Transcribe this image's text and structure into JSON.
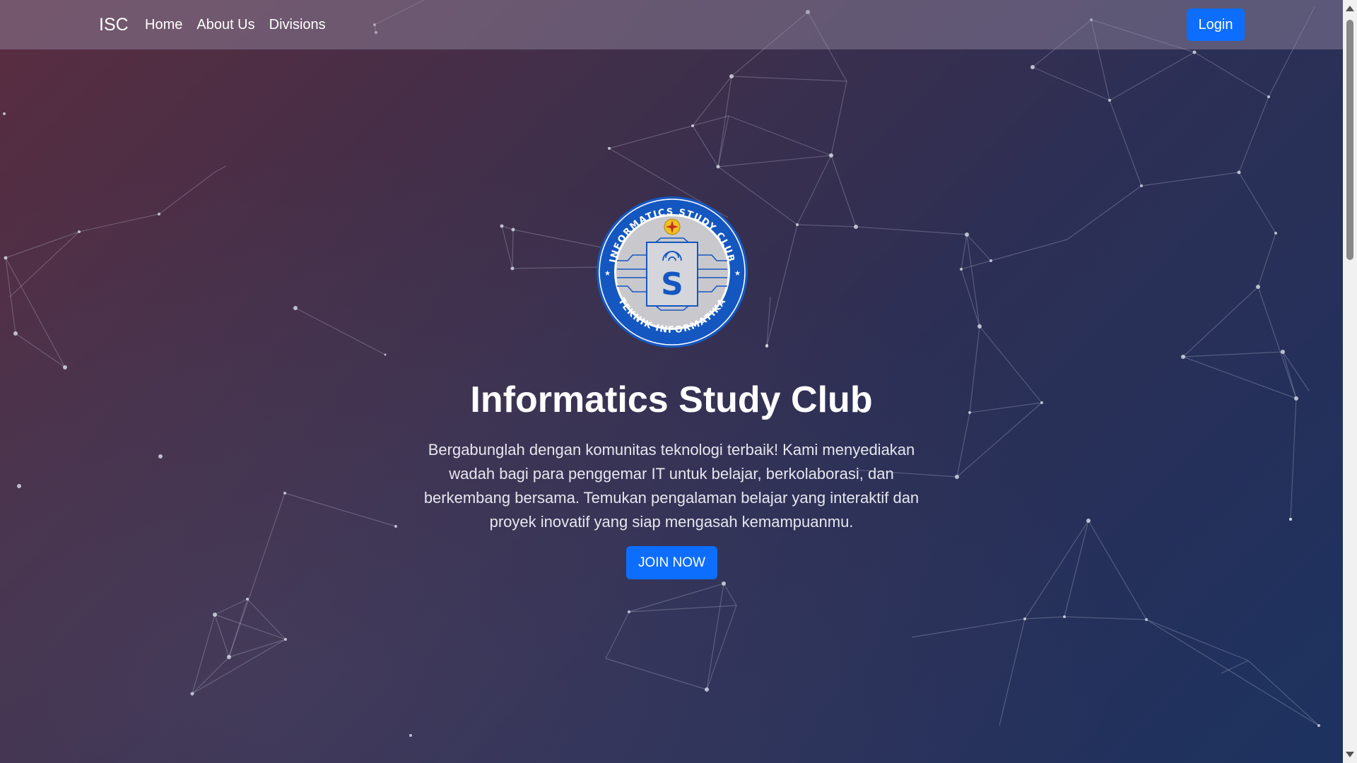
{
  "navbar": {
    "brand": "ISC",
    "links": [
      {
        "label": "Home"
      },
      {
        "label": "About Us"
      },
      {
        "label": "Divisions"
      }
    ],
    "login_label": "Login"
  },
  "hero": {
    "logo_ring_top": "INFORMATICS STUDY CLUB",
    "logo_ring_bottom": "TEKNIK INFORMATIKA",
    "title": "Informatics Study Club",
    "description": "Bergabunglah dengan komunitas teknologi terbaik! Kami menyediakan wadah bagi para penggemar IT untuk belajar, berkolaborasi, dan berkembang bersama. Temukan pengalaman belajar yang interaktif dan proyek inovatif yang siap mengasah kemampuanmu.",
    "join_label": "JOIN NOW"
  },
  "colors": {
    "primary_button": "#0d6efd",
    "logo_ring": "#1557c0"
  }
}
